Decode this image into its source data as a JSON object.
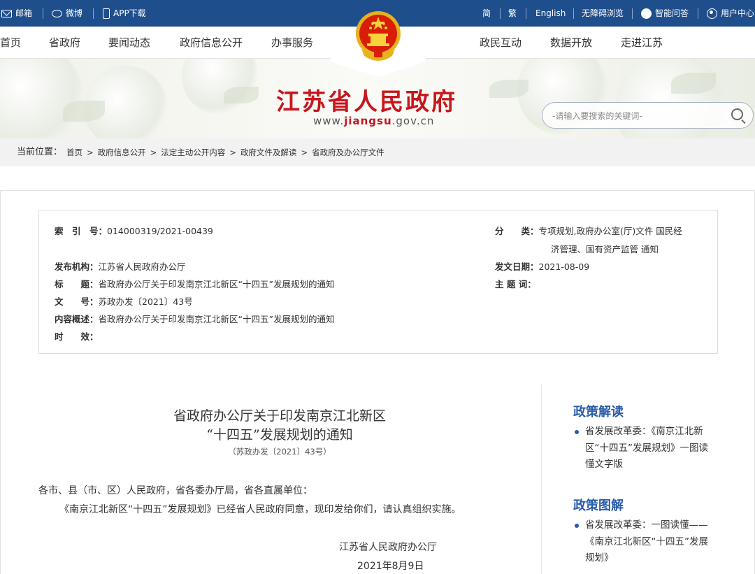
{
  "topbar": {
    "left": [
      {
        "icon": "mail-icon",
        "label": "邮箱"
      },
      {
        "icon": "weibo-icon",
        "label": "微博"
      },
      {
        "icon": "phone-icon",
        "label": "APP下载"
      }
    ],
    "right": {
      "simplified": "简",
      "traditional": "繁",
      "english": "English",
      "accessible": "无障碍浏览",
      "qa": "智能问答",
      "user": "用户中心"
    }
  },
  "nav": {
    "left": [
      "首页",
      "省政府",
      "要闻动态",
      "政府信息公开",
      "办事服务"
    ],
    "right": [
      "政民互动",
      "数据开放",
      "走进江苏"
    ]
  },
  "header": {
    "title": "江苏省人民政府",
    "url_prefix": "www.",
    "url_domain": "jiangsu",
    "url_suffix": ".gov.cn",
    "search_placeholder": "-请输入要搜索的关键词-"
  },
  "breadcrumb": {
    "label": "当前位置：",
    "items": [
      "首页",
      "政府信息公开",
      "法定主动公开内容",
      "政府文件及解读",
      "省政府及办公厅文件"
    ],
    "separator": ">"
  },
  "meta": {
    "index_key": "索　引　号：",
    "index_value": "014000319/2021-00439",
    "category_key": "分　　类：",
    "category_value_line1": "专项规划,政府办公室(厅)文件 国民经",
    "category_value_line2": "济管理、国有资产监管 通知",
    "issuer_key": "发布机构：",
    "issuer_value": "江苏省人民政府办公厅",
    "date_key": "发文日期：",
    "date_value": "2021-08-09",
    "title_key": "标　　题：",
    "title_value": "省政府办公厅关于印发南京江北新区“十四五”发展规划的通知",
    "subject_key": "主 题 词：",
    "subject_value": "",
    "docno_key": "文　　号：",
    "docno_value": "苏政办发〔2021〕43号",
    "summary_key": "内容概述：",
    "summary_value": "省政府办公厅关于印发南京江北新区“十四五”发展规划的通知",
    "validity_key": "时　　效：",
    "validity_value": ""
  },
  "document": {
    "title_line1": "省政府办公厅关于印发南京江北新区",
    "title_line2": "“十四五”发展规划的通知",
    "doc_number": "（苏政办发〔2021〕43号）",
    "salutation": "各市、县（市、区）人民政府，省各委办厅局，省各直属单位：",
    "paragraph": "《南京江北新区“十四五”发展规划》已经省人民政府同意，现印发给你们，请认真组织实施。",
    "signature": "江苏省人民政府办公厅",
    "date": "2021年8月9日"
  },
  "sidebar": {
    "interpretation_heading": "政策解读",
    "interpretation_item": "省发展改革委：《南京江北新区“十四五”发展规划》一图读懂文字版",
    "illustration_heading": "政策图解",
    "illustration_item": "省发展改革委：一图读懂——《南京江北新区“十四五”发展规划》"
  },
  "colors": {
    "topbar": "#1f4e8c",
    "title_red": "#c8161d",
    "accent_blue": "#2a5caa"
  }
}
